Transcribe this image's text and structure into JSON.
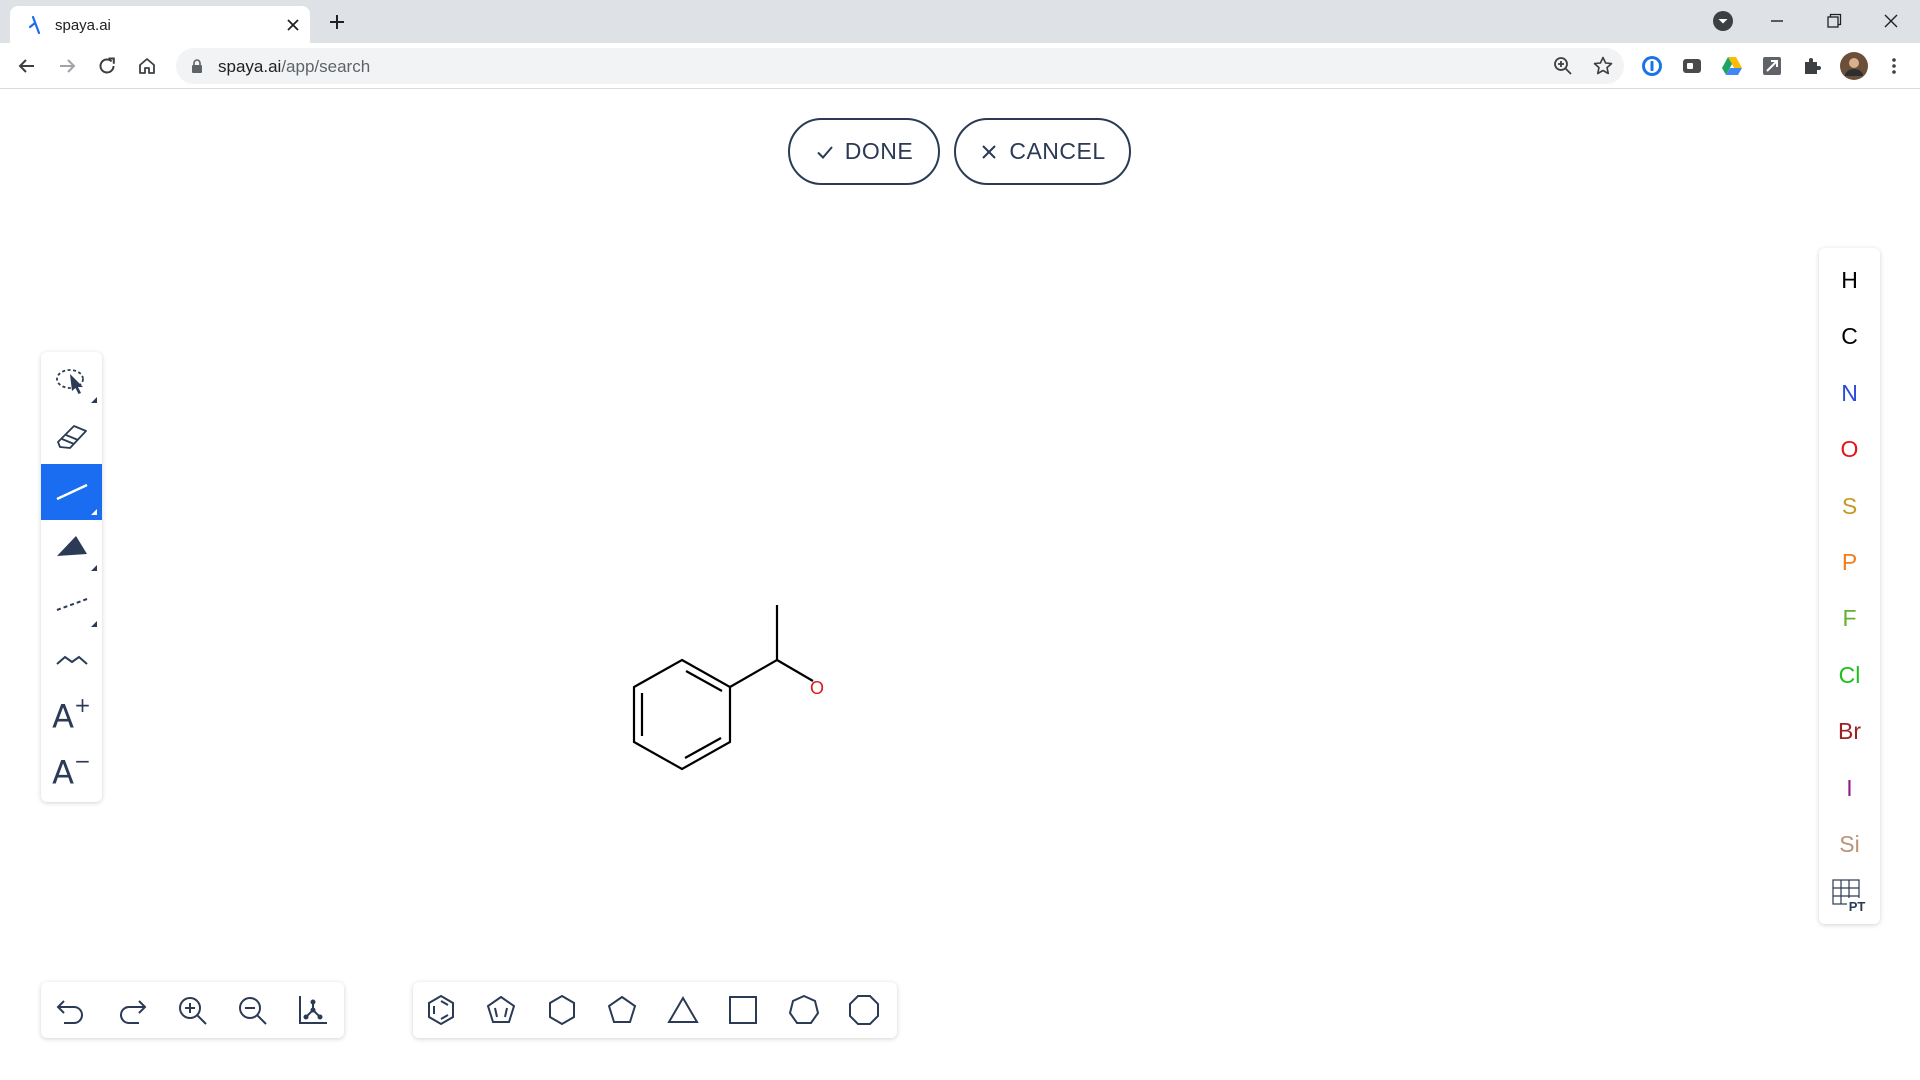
{
  "browser": {
    "tab_title": "spaya.ai",
    "url_host": "spaya.ai",
    "url_path": "/app/search"
  },
  "actions": {
    "done_label": "DONE",
    "cancel_label": "CANCEL"
  },
  "left_tools": [
    {
      "icon": "lasso-select-icon"
    },
    {
      "icon": "eraser-icon"
    },
    {
      "icon": "single-bond-icon",
      "active": true
    },
    {
      "icon": "wedge-bond-icon"
    },
    {
      "icon": "dashed-bond-icon"
    },
    {
      "icon": "chain-icon"
    },
    {
      "label": "A",
      "icon": "charge-plus-icon"
    },
    {
      "label": "A",
      "icon": "charge-minus-icon"
    }
  ],
  "atoms": [
    {
      "symbol": "H",
      "color": "#000000"
    },
    {
      "symbol": "C",
      "color": "#000000"
    },
    {
      "symbol": "N",
      "color": "#2c4bd9"
    },
    {
      "symbol": "O",
      "color": "#e3141e"
    },
    {
      "symbol": "S",
      "color": "#c39b23"
    },
    {
      "symbol": "P",
      "color": "#f07f1a"
    },
    {
      "symbol": "F",
      "color": "#61b22e"
    },
    {
      "symbol": "Cl",
      "color": "#1fbf1f"
    },
    {
      "symbol": "Br",
      "color": "#9c2124"
    },
    {
      "symbol": "I",
      "color": "#8f1a8f"
    },
    {
      "symbol": "Si",
      "color": "#b89478"
    }
  ],
  "periodic_table_label": "PT",
  "molecule": {
    "atom_label": "O",
    "atom_color": "#e3141e"
  }
}
